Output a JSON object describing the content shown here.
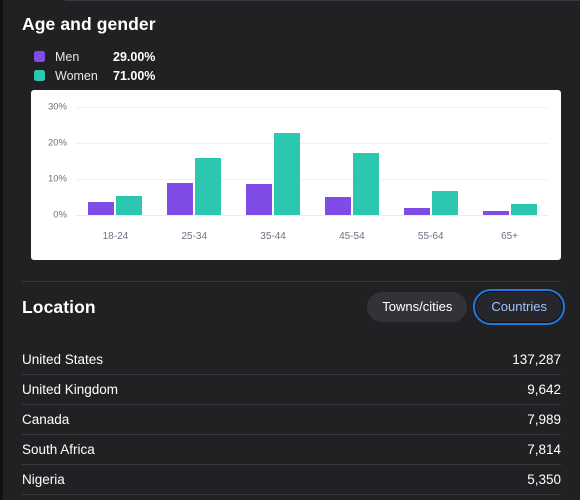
{
  "age_section": {
    "title": "Age and gender",
    "legend": [
      {
        "name": "Men",
        "value": "29.00%",
        "color": "#7f4ce6"
      },
      {
        "name": "Women",
        "value": "71.00%",
        "color": "#2cc7b0"
      }
    ]
  },
  "chart_data": {
    "type": "bar",
    "title": "Age and gender",
    "xlabel": "",
    "ylabel": "",
    "ylim": [
      0,
      30
    ],
    "grid": true,
    "legend_position": "above-chart",
    "categories": [
      "18-24",
      "25-34",
      "35-44",
      "45-54",
      "55-64",
      "65+"
    ],
    "ytick_labels": [
      "0%",
      "10%",
      "20%",
      "30%"
    ],
    "ytick_values": [
      0,
      10,
      20,
      30
    ],
    "series": [
      {
        "name": "Men",
        "color": "#7f4ce6",
        "values": [
          3.6,
          8.8,
          8.5,
          5.0,
          2.0,
          1.0
        ]
      },
      {
        "name": "Women",
        "color": "#2cc7b0",
        "values": [
          5.2,
          15.7,
          22.9,
          17.1,
          6.8,
          3.0
        ]
      }
    ]
  },
  "location_section": {
    "title": "Location",
    "toggles": [
      {
        "label": "Towns/cities",
        "active": false
      },
      {
        "label": "Countries",
        "active": true
      }
    ],
    "rows": [
      {
        "name": "United States",
        "value": "137,287"
      },
      {
        "name": "United Kingdom",
        "value": "9,642"
      },
      {
        "name": "Canada",
        "value": "7,989"
      },
      {
        "name": "South Africa",
        "value": "7,814"
      },
      {
        "name": "Nigeria",
        "value": "5,350"
      }
    ]
  }
}
